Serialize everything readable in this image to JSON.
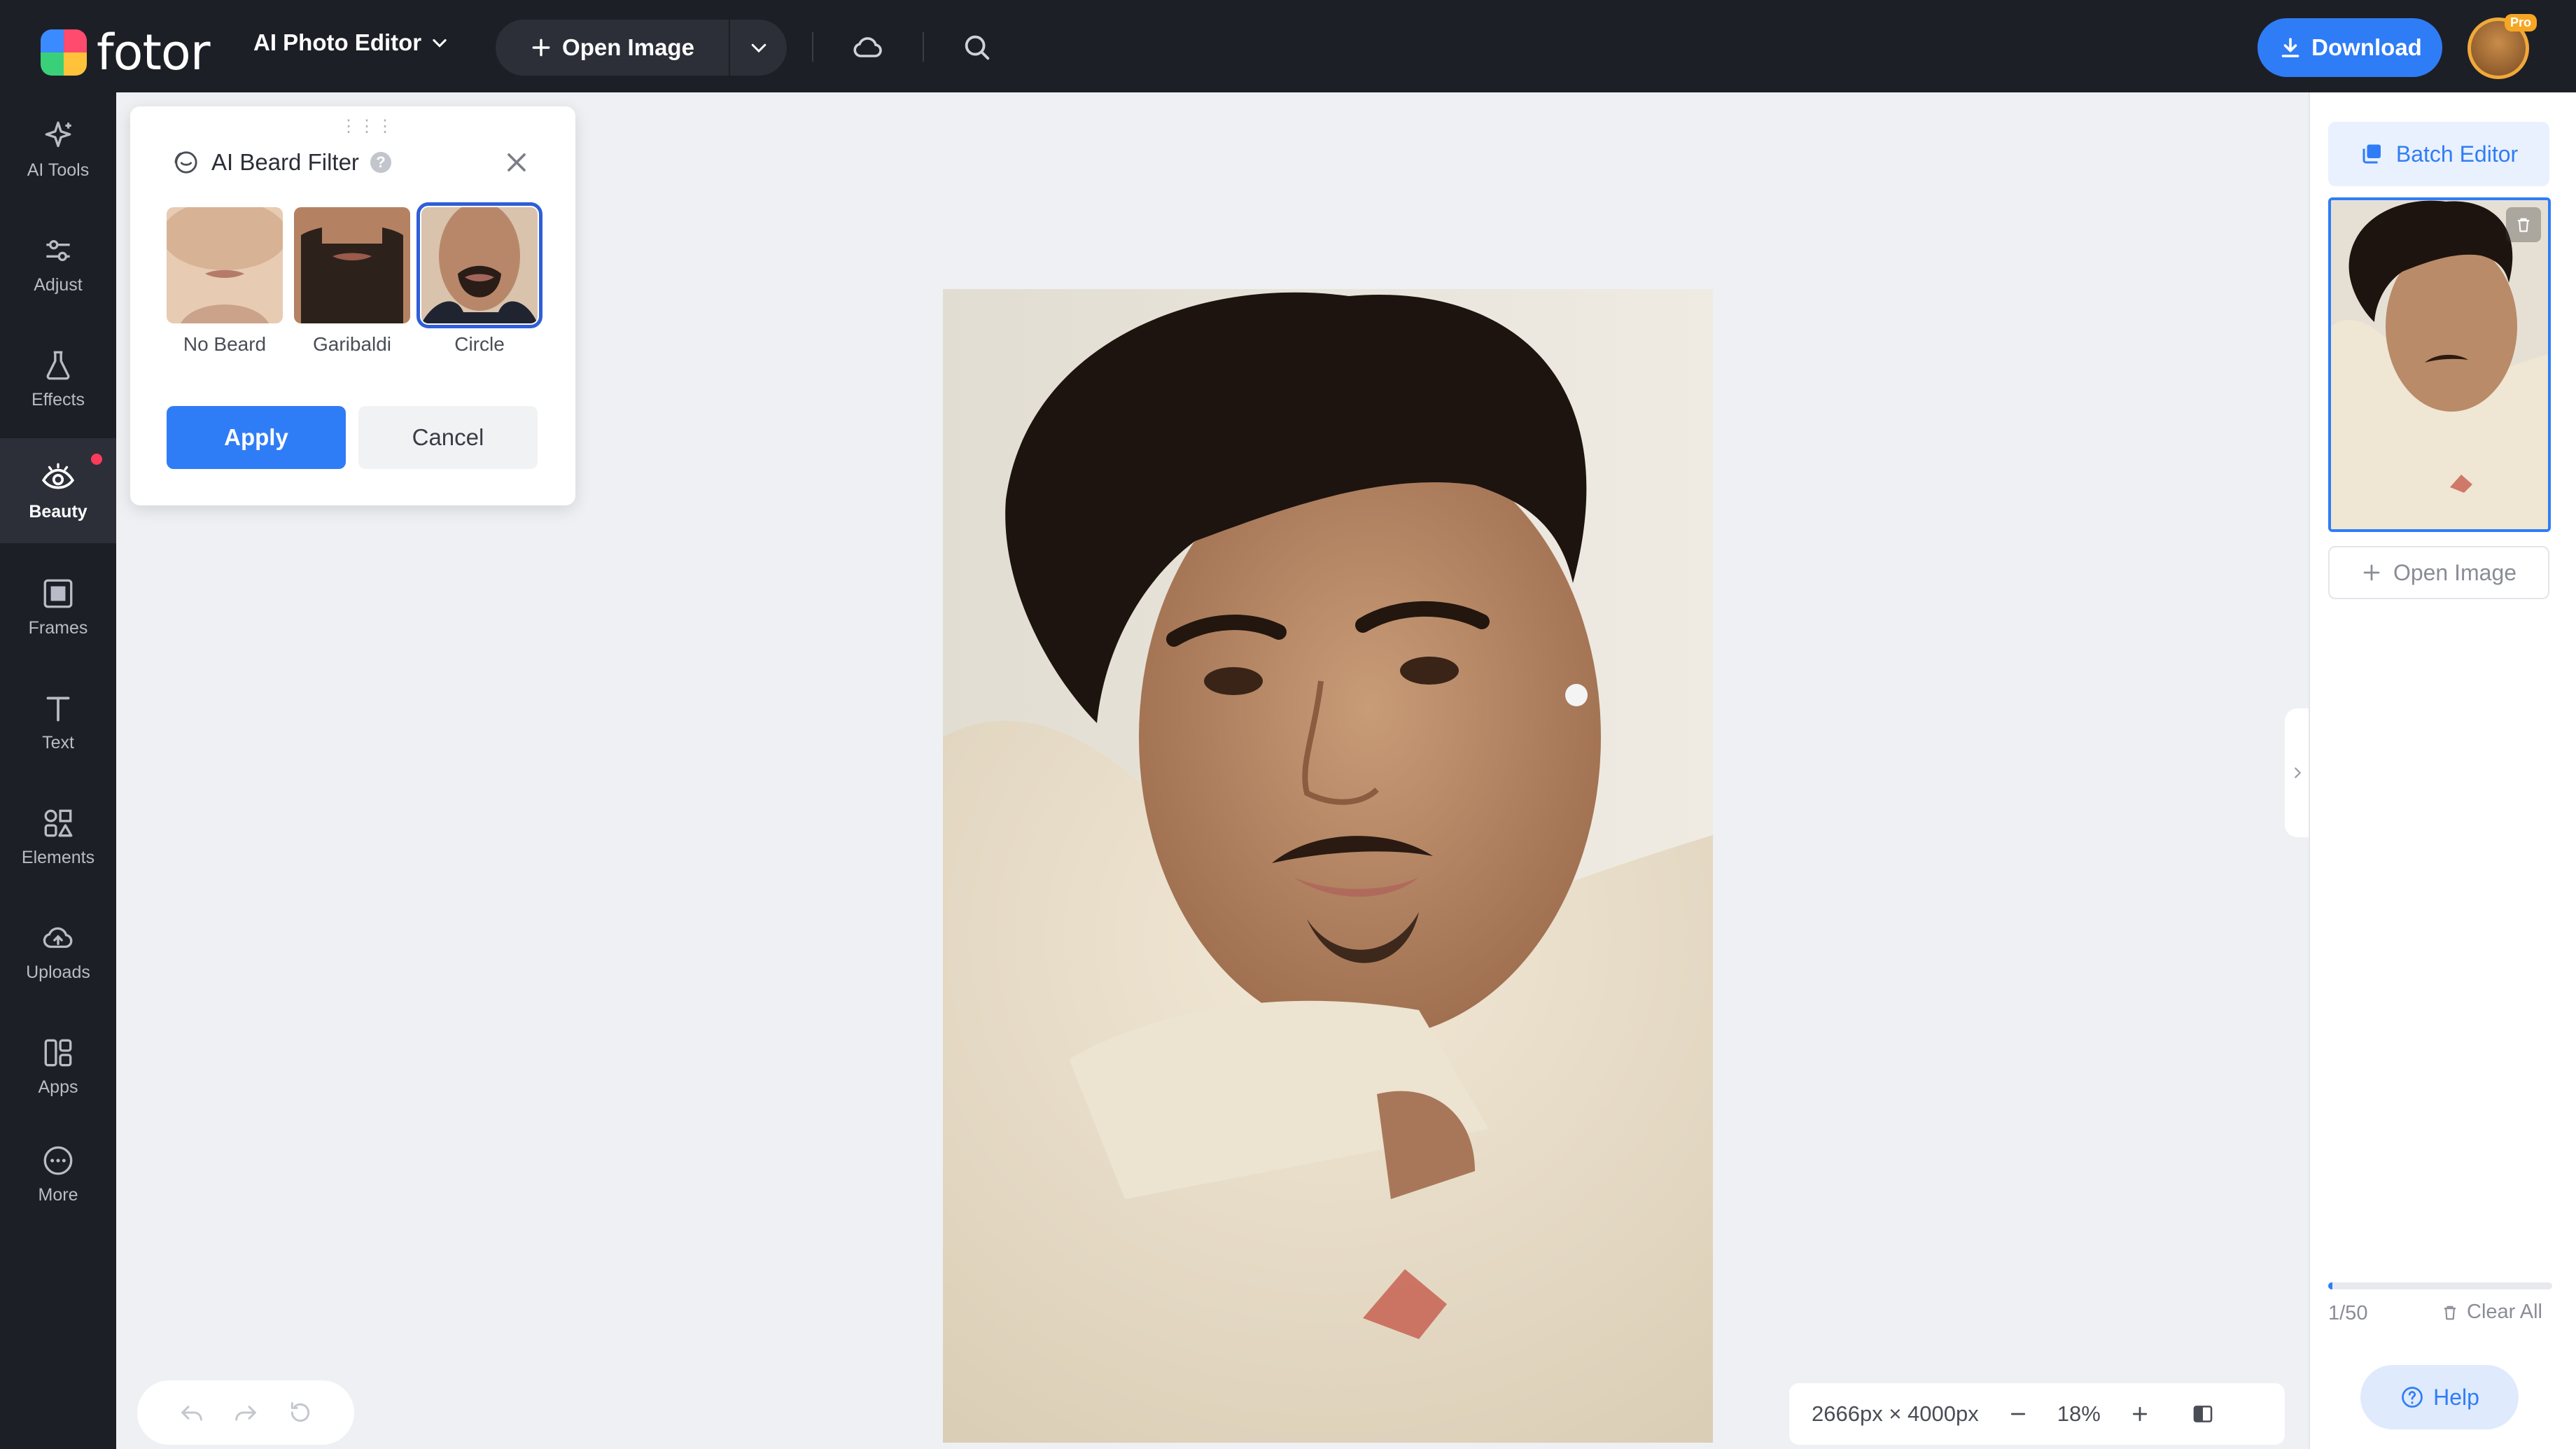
{
  "app": {
    "logo_text": "fotor",
    "editor_menu_label": "AI Photo Editor",
    "open_image_label": "Open Image",
    "download_label": "Download",
    "pro_badge": "Pro"
  },
  "leftnav": {
    "items": [
      {
        "label": "AI Tools",
        "icon": "sparkle-icon"
      },
      {
        "label": "Adjust",
        "icon": "sliders-icon"
      },
      {
        "label": "Effects",
        "icon": "flask-icon"
      },
      {
        "label": "Beauty",
        "icon": "eye-icon",
        "active": true,
        "has_dot": true
      },
      {
        "label": "Frames",
        "icon": "frame-icon"
      },
      {
        "label": "Text",
        "icon": "text-icon"
      },
      {
        "label": "Elements",
        "icon": "shapes-icon"
      },
      {
        "label": "Uploads",
        "icon": "cloud-upload-icon"
      },
      {
        "label": "Apps",
        "icon": "apps-icon"
      },
      {
        "label": "More",
        "icon": "more-icon"
      }
    ]
  },
  "panel": {
    "title": "AI Beard Filter",
    "options": [
      {
        "label": "No Beard"
      },
      {
        "label": "Garibaldi"
      },
      {
        "label": "Circle",
        "selected": true
      }
    ],
    "apply_label": "Apply",
    "cancel_label": "Cancel"
  },
  "zoom": {
    "dimensions": "2666px × 4000px",
    "level": "18%"
  },
  "rightpanel": {
    "batch_editor_label": "Batch Editor",
    "open_image_label": "Open Image",
    "count": "1/50",
    "count_fraction": 0.02,
    "clear_all_label": "Clear All",
    "help_label": "Help"
  },
  "colors": {
    "accent": "#2f7df6",
    "dark": "#1d1f26",
    "canvas": "#eef0f3",
    "badge": "#ff3b5c"
  }
}
